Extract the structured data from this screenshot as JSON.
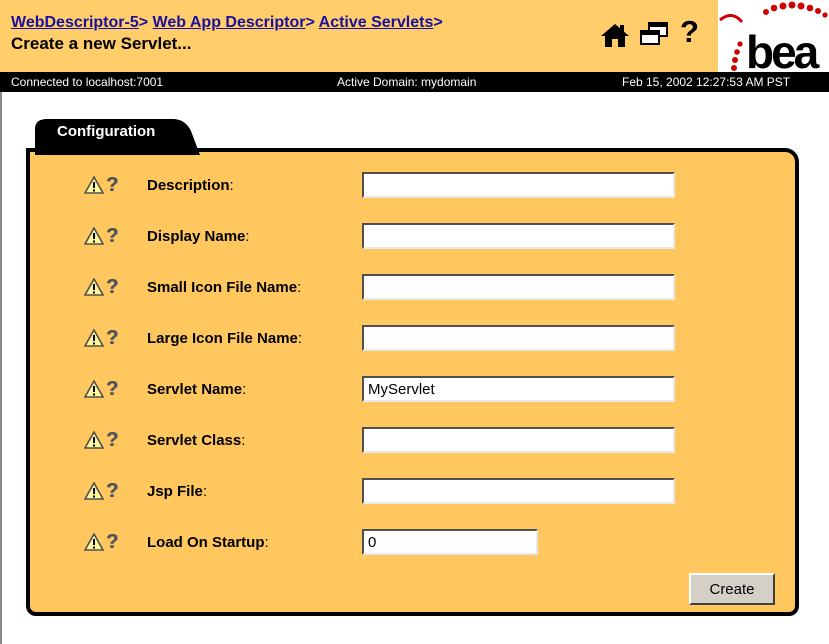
{
  "header": {
    "breadcrumb": [
      "WebDescriptor-5",
      "Web App Descriptor",
      "Active Servlets"
    ],
    "separator": ">",
    "page_title": "Create a new Servlet...",
    "logo_text": "bea"
  },
  "status_bar": {
    "connection": "Connected to localhost:7001",
    "domain": "Active Domain: mydomain",
    "datetime": "Feb 15, 2002 12:27:53 AM PST"
  },
  "tab": {
    "label": "Configuration"
  },
  "form": {
    "fields": [
      {
        "label": "Description",
        "value": ""
      },
      {
        "label": "Display Name",
        "value": ""
      },
      {
        "label": "Small Icon File Name",
        "value": ""
      },
      {
        "label": "Large Icon File Name",
        "value": ""
      },
      {
        "label": "Servlet Name",
        "value": "MyServlet"
      },
      {
        "label": "Servlet Class",
        "value": ""
      },
      {
        "label": "Jsp File",
        "value": ""
      },
      {
        "label": "Load On Startup",
        "value": "0"
      }
    ],
    "label_suffix": ":",
    "create_label": "Create"
  },
  "colors": {
    "header_bg": "#ffce6b",
    "panel_bg": "#ffc75d",
    "link": "#1a0f9e",
    "logo_red": "#cc0000"
  }
}
